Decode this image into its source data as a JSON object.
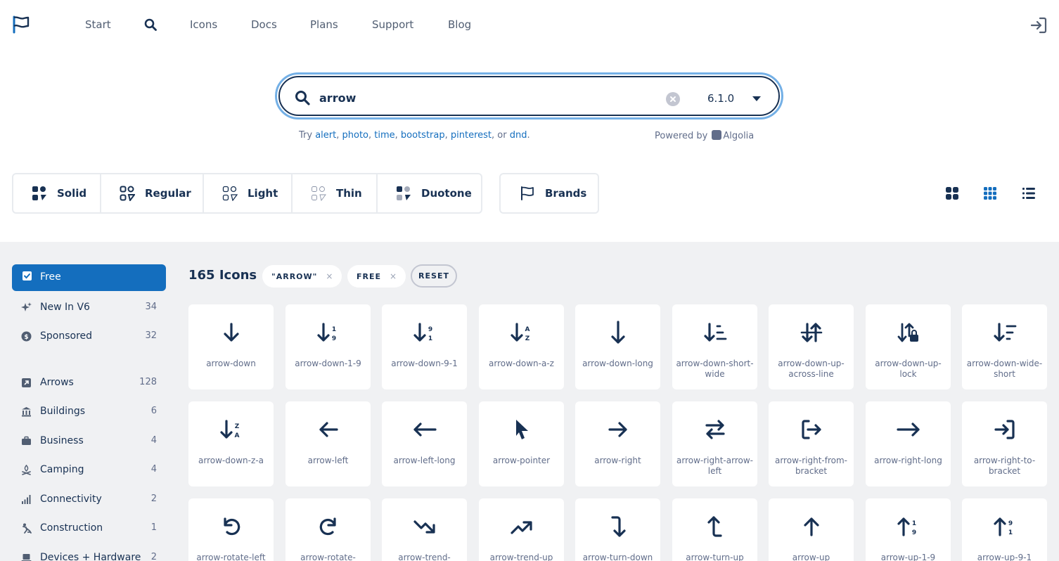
{
  "nav": {
    "items": [
      "Start",
      "Icons",
      "Docs",
      "Plans",
      "Support",
      "Blog"
    ]
  },
  "search": {
    "value": "arrow",
    "version": "6.1.0"
  },
  "hint": {
    "try": "Try",
    "suggestions": [
      "alert",
      "photo",
      "time",
      "bootstrap",
      "pinterest",
      "dnd"
    ],
    "or": ", or",
    "period": ".",
    "powered_by": "Powered by",
    "provider": "Algolia"
  },
  "styles": [
    "Solid",
    "Regular",
    "Light",
    "Thin",
    "Duotone"
  ],
  "brands_label": "Brands",
  "sidebar": {
    "free_label": "Free",
    "top": [
      {
        "label": "New In V6",
        "count": "34",
        "icon": "sparkles-icon"
      },
      {
        "label": "Sponsored",
        "count": "32",
        "icon": "dollar-circle-icon"
      }
    ],
    "categories": [
      {
        "label": "Arrows",
        "count": "128",
        "icon": "square-arrow-icon"
      },
      {
        "label": "Buildings",
        "count": "6",
        "icon": "building-columns-icon"
      },
      {
        "label": "Business",
        "count": "4",
        "icon": "briefcase-icon"
      },
      {
        "label": "Camping",
        "count": "4",
        "icon": "campfire-icon"
      },
      {
        "label": "Connectivity",
        "count": "2",
        "icon": "signal-icon"
      },
      {
        "label": "Construction",
        "count": "1",
        "icon": "person-digging-icon"
      },
      {
        "label": "Devices + Hardware",
        "count": "2",
        "icon": "laptop-icon"
      }
    ]
  },
  "results": {
    "count_label": "165 Icons",
    "chips": [
      {
        "label": "\"ARROW\"",
        "x": "×"
      },
      {
        "label": "FREE",
        "x": "×"
      }
    ],
    "reset": "RESET"
  },
  "icons": [
    {
      "name": "arrow-down",
      "glyph": "down"
    },
    {
      "name": "arrow-down-1-9",
      "glyph": "down-19"
    },
    {
      "name": "arrow-down-9-1",
      "glyph": "down-91"
    },
    {
      "name": "arrow-down-a-z",
      "glyph": "down-az"
    },
    {
      "name": "arrow-down-long",
      "glyph": "down-long"
    },
    {
      "name": "arrow-down-short-wide",
      "glyph": "down-short-wide"
    },
    {
      "name": "arrow-down-up-across-line",
      "glyph": "down-up-line"
    },
    {
      "name": "arrow-down-up-lock",
      "glyph": "down-up-lock"
    },
    {
      "name": "arrow-down-wide-short",
      "glyph": "down-wide-short"
    },
    {
      "name": "arrow-down-z-a",
      "glyph": "down-za"
    },
    {
      "name": "arrow-left",
      "glyph": "left"
    },
    {
      "name": "arrow-left-long",
      "glyph": "left-long"
    },
    {
      "name": "arrow-pointer",
      "glyph": "pointer"
    },
    {
      "name": "arrow-right",
      "glyph": "right"
    },
    {
      "name": "arrow-right-arrow-left",
      "glyph": "right-left"
    },
    {
      "name": "arrow-right-from-bracket",
      "glyph": "from-bracket"
    },
    {
      "name": "arrow-right-long",
      "glyph": "right-long"
    },
    {
      "name": "arrow-right-to-bracket",
      "glyph": "to-bracket"
    },
    {
      "name": "arrow-rotate-left",
      "glyph": "rotate-left"
    },
    {
      "name": "arrow-rotate-",
      "glyph": "rotate-right"
    },
    {
      "name": "arrow-trend-",
      "glyph": "trend-down"
    },
    {
      "name": "arrow-trend-up",
      "glyph": "trend-up"
    },
    {
      "name": "arrow-turn-down",
      "glyph": "turn-down"
    },
    {
      "name": "arrow-turn-up",
      "glyph": "turn-up"
    },
    {
      "name": "arrow-up",
      "glyph": "up"
    },
    {
      "name": "arrow-up-1-9",
      "glyph": "up-19"
    },
    {
      "name": "arrow-up-9-1",
      "glyph": "up-91"
    }
  ]
}
